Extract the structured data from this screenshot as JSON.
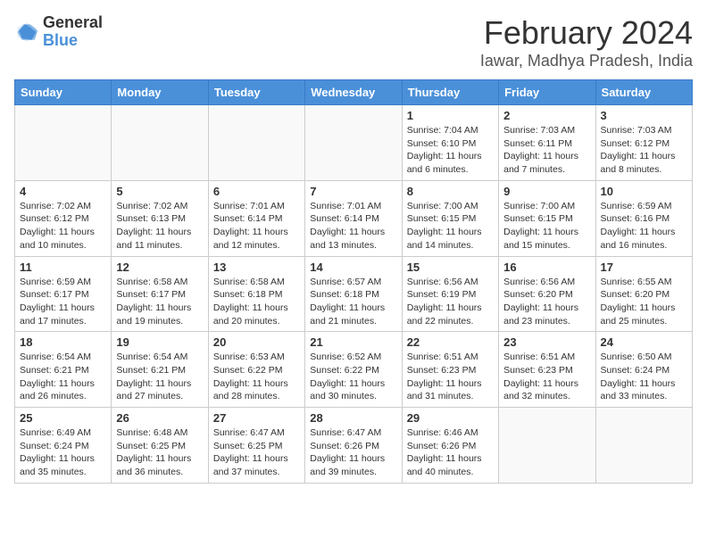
{
  "header": {
    "logo_general": "General",
    "logo_blue": "Blue",
    "month": "February 2024",
    "location": "Iawar, Madhya Pradesh, India"
  },
  "weekdays": [
    "Sunday",
    "Monday",
    "Tuesday",
    "Wednesday",
    "Thursday",
    "Friday",
    "Saturday"
  ],
  "weeks": [
    [
      {
        "day": "",
        "info": ""
      },
      {
        "day": "",
        "info": ""
      },
      {
        "day": "",
        "info": ""
      },
      {
        "day": "",
        "info": ""
      },
      {
        "day": "1",
        "info": "Sunrise: 7:04 AM\nSunset: 6:10 PM\nDaylight: 11 hours and 6 minutes."
      },
      {
        "day": "2",
        "info": "Sunrise: 7:03 AM\nSunset: 6:11 PM\nDaylight: 11 hours and 7 minutes."
      },
      {
        "day": "3",
        "info": "Sunrise: 7:03 AM\nSunset: 6:12 PM\nDaylight: 11 hours and 8 minutes."
      }
    ],
    [
      {
        "day": "4",
        "info": "Sunrise: 7:02 AM\nSunset: 6:12 PM\nDaylight: 11 hours and 10 minutes."
      },
      {
        "day": "5",
        "info": "Sunrise: 7:02 AM\nSunset: 6:13 PM\nDaylight: 11 hours and 11 minutes."
      },
      {
        "day": "6",
        "info": "Sunrise: 7:01 AM\nSunset: 6:14 PM\nDaylight: 11 hours and 12 minutes."
      },
      {
        "day": "7",
        "info": "Sunrise: 7:01 AM\nSunset: 6:14 PM\nDaylight: 11 hours and 13 minutes."
      },
      {
        "day": "8",
        "info": "Sunrise: 7:00 AM\nSunset: 6:15 PM\nDaylight: 11 hours and 14 minutes."
      },
      {
        "day": "9",
        "info": "Sunrise: 7:00 AM\nSunset: 6:15 PM\nDaylight: 11 hours and 15 minutes."
      },
      {
        "day": "10",
        "info": "Sunrise: 6:59 AM\nSunset: 6:16 PM\nDaylight: 11 hours and 16 minutes."
      }
    ],
    [
      {
        "day": "11",
        "info": "Sunrise: 6:59 AM\nSunset: 6:17 PM\nDaylight: 11 hours and 17 minutes."
      },
      {
        "day": "12",
        "info": "Sunrise: 6:58 AM\nSunset: 6:17 PM\nDaylight: 11 hours and 19 minutes."
      },
      {
        "day": "13",
        "info": "Sunrise: 6:58 AM\nSunset: 6:18 PM\nDaylight: 11 hours and 20 minutes."
      },
      {
        "day": "14",
        "info": "Sunrise: 6:57 AM\nSunset: 6:18 PM\nDaylight: 11 hours and 21 minutes."
      },
      {
        "day": "15",
        "info": "Sunrise: 6:56 AM\nSunset: 6:19 PM\nDaylight: 11 hours and 22 minutes."
      },
      {
        "day": "16",
        "info": "Sunrise: 6:56 AM\nSunset: 6:20 PM\nDaylight: 11 hours and 23 minutes."
      },
      {
        "day": "17",
        "info": "Sunrise: 6:55 AM\nSunset: 6:20 PM\nDaylight: 11 hours and 25 minutes."
      }
    ],
    [
      {
        "day": "18",
        "info": "Sunrise: 6:54 AM\nSunset: 6:21 PM\nDaylight: 11 hours and 26 minutes."
      },
      {
        "day": "19",
        "info": "Sunrise: 6:54 AM\nSunset: 6:21 PM\nDaylight: 11 hours and 27 minutes."
      },
      {
        "day": "20",
        "info": "Sunrise: 6:53 AM\nSunset: 6:22 PM\nDaylight: 11 hours and 28 minutes."
      },
      {
        "day": "21",
        "info": "Sunrise: 6:52 AM\nSunset: 6:22 PM\nDaylight: 11 hours and 30 minutes."
      },
      {
        "day": "22",
        "info": "Sunrise: 6:51 AM\nSunset: 6:23 PM\nDaylight: 11 hours and 31 minutes."
      },
      {
        "day": "23",
        "info": "Sunrise: 6:51 AM\nSunset: 6:23 PM\nDaylight: 11 hours and 32 minutes."
      },
      {
        "day": "24",
        "info": "Sunrise: 6:50 AM\nSunset: 6:24 PM\nDaylight: 11 hours and 33 minutes."
      }
    ],
    [
      {
        "day": "25",
        "info": "Sunrise: 6:49 AM\nSunset: 6:24 PM\nDaylight: 11 hours and 35 minutes."
      },
      {
        "day": "26",
        "info": "Sunrise: 6:48 AM\nSunset: 6:25 PM\nDaylight: 11 hours and 36 minutes."
      },
      {
        "day": "27",
        "info": "Sunrise: 6:47 AM\nSunset: 6:25 PM\nDaylight: 11 hours and 37 minutes."
      },
      {
        "day": "28",
        "info": "Sunrise: 6:47 AM\nSunset: 6:26 PM\nDaylight: 11 hours and 39 minutes."
      },
      {
        "day": "29",
        "info": "Sunrise: 6:46 AM\nSunset: 6:26 PM\nDaylight: 11 hours and 40 minutes."
      },
      {
        "day": "",
        "info": ""
      },
      {
        "day": "",
        "info": ""
      }
    ]
  ]
}
